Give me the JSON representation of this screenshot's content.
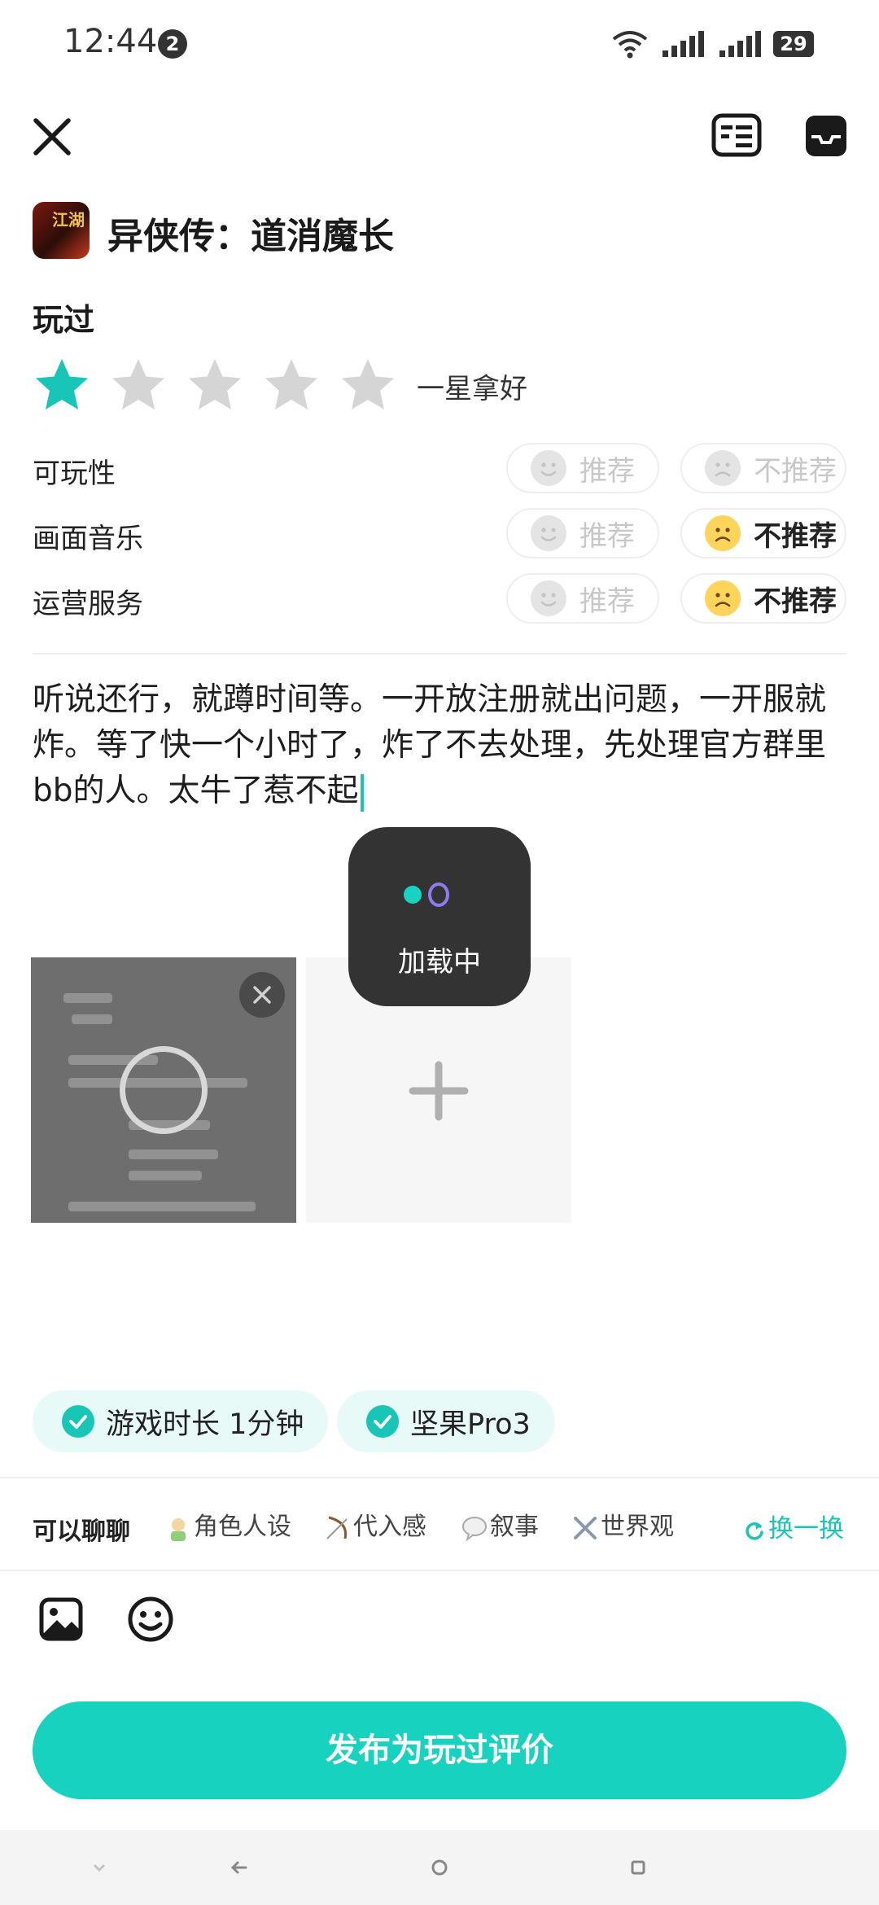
{
  "status_bar": {
    "time": "12:44",
    "notification_count": "2",
    "battery": "29"
  },
  "toolbar": {
    "rules_icon": "review-rules-icon",
    "draft_icon": "draft-box-icon"
  },
  "game": {
    "title": "异侠传：道消魔长",
    "icon_text": "江湖"
  },
  "rating": {
    "label": "玩过",
    "stars_filled": 1,
    "stars_total": 5,
    "caption": "一星拿好",
    "colors": {
      "active": "#17C6B6",
      "inactive": "#D5D5D5"
    }
  },
  "aspects": [
    {
      "label": "可玩性",
      "recommend": "推荐",
      "not_recommend": "不推荐",
      "selected": "none"
    },
    {
      "label": "画面音乐",
      "recommend": "推荐",
      "not_recommend": "不推荐",
      "selected": "not_recommend"
    },
    {
      "label": "运营服务",
      "recommend": "推荐",
      "not_recommend": "不推荐",
      "selected": "not_recommend"
    }
  ],
  "review": {
    "text": "听说还行，就蹲时间等。一开放注册就出问题，一开服就炸。等了快一个小时了，炸了不去处理，先处理官方群里bb的人。太牛了惹不起"
  },
  "loading": {
    "text": "加载中"
  },
  "tags": [
    {
      "label": "游戏时长 1分钟"
    },
    {
      "label": "坚果Pro3"
    }
  ],
  "chat_topics": {
    "title": "可以聊聊",
    "items": [
      {
        "label": "角色人设",
        "icon": "character-emoji"
      },
      {
        "label": "代入感",
        "icon": "bow-emoji"
      },
      {
        "label": "叙事",
        "icon": "speech-bubble-emoji"
      },
      {
        "label": "世界观",
        "icon": "crossed-swords-emoji"
      }
    ],
    "swap_label": "换一换"
  },
  "publish": {
    "label": "发布为玩过评价",
    "color": "#17D2BF"
  }
}
